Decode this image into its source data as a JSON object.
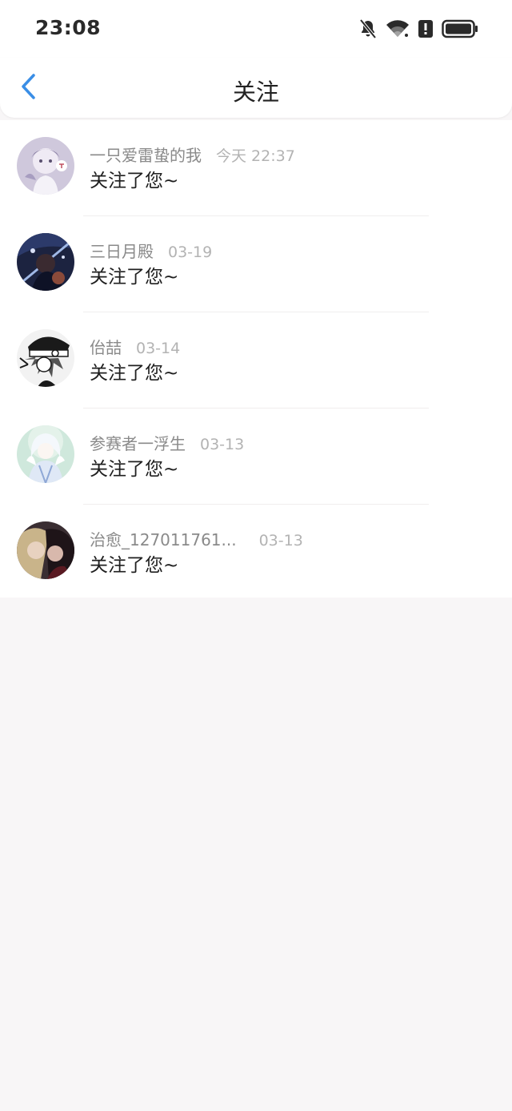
{
  "status_bar": {
    "time": "23:08",
    "icons": [
      "bell-off-icon",
      "wifi-icon",
      "alert-icon",
      "battery-icon"
    ]
  },
  "nav": {
    "back_icon": "chevron-left-icon",
    "title": "关注",
    "accent_color": "#3a8ee6"
  },
  "follows": [
    {
      "name": "一只爱雷蛰的我",
      "time": "今天 22:37",
      "message": "关注了您~",
      "avatar": "avatar-lavender-character"
    },
    {
      "name": "三日月殿",
      "time": "03-19",
      "message": "关注了您~",
      "avatar": "avatar-dark-blue-character"
    },
    {
      "name": "佁喆",
      "time": "03-14",
      "message": "关注了您~",
      "avatar": "avatar-monochrome-character"
    },
    {
      "name": "参赛者一浮生",
      "time": "03-13",
      "message": "关注了您~",
      "avatar": "avatar-white-hair-character"
    },
    {
      "name": "治愈_127011761...",
      "time": "03-13",
      "message": "关注了您~",
      "avatar": "avatar-dark-couple"
    }
  ]
}
